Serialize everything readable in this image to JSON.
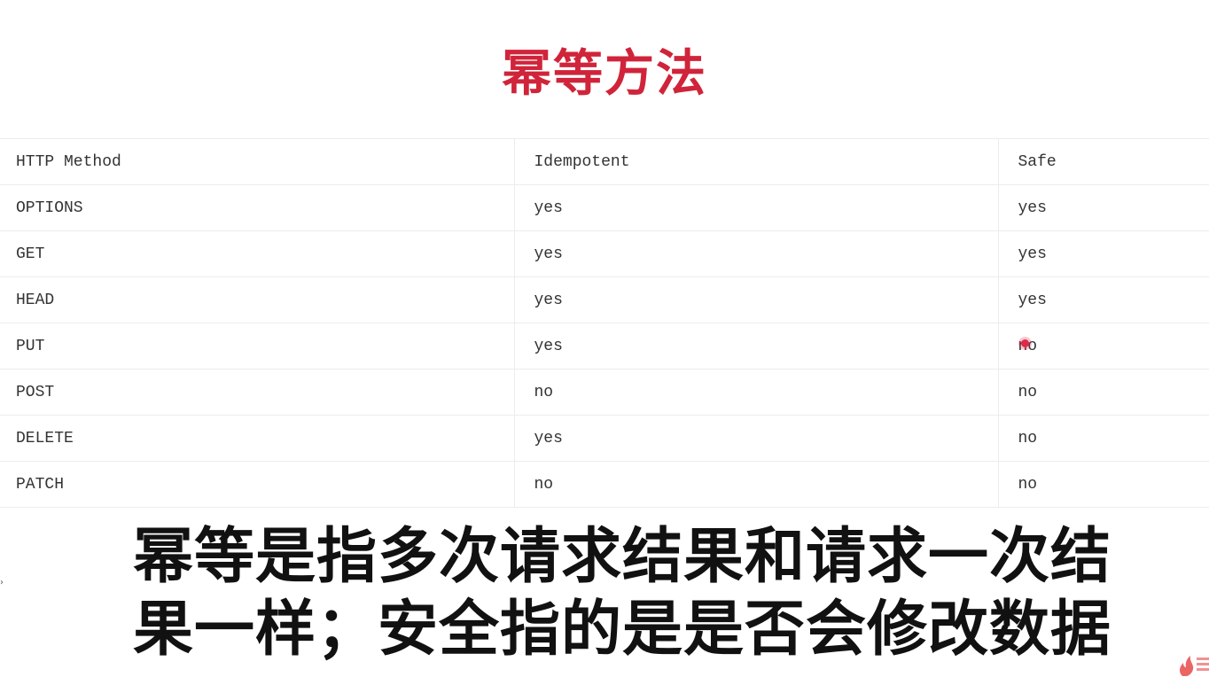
{
  "title": "幂等方法",
  "table": {
    "headers": [
      "HTTP Method",
      "Idempotent",
      "Safe"
    ],
    "rows": [
      [
        "OPTIONS",
        "yes",
        "yes"
      ],
      [
        "GET",
        "yes",
        "yes"
      ],
      [
        "HEAD",
        "yes",
        "yes"
      ],
      [
        "PUT",
        "yes",
        "no"
      ],
      [
        "POST",
        "no",
        "no"
      ],
      [
        "DELETE",
        "yes",
        "no"
      ],
      [
        "PATCH",
        "no",
        "no"
      ]
    ]
  },
  "subtitle": {
    "line1": "幂等是指多次请求结果和请求一次结",
    "line2": "果一样；安全指的是是否会修改数据"
  },
  "colors": {
    "title": "#d0243a",
    "cursor": "#e0294a",
    "logo": "#e84a4a"
  },
  "icons": {
    "cursor": "cursor-dot-icon",
    "arrow": "chevron-right-icon",
    "logo": "flame-logo-icon"
  }
}
